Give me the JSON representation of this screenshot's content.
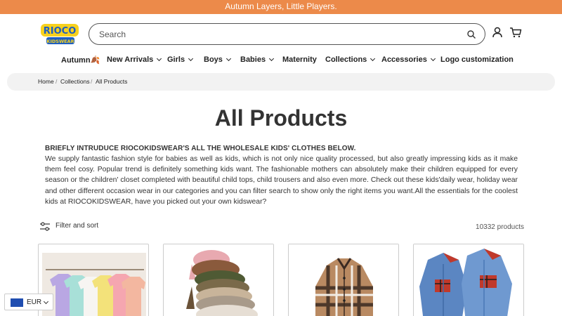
{
  "announcement": "Autumn Layers, Little Players.",
  "brand": {
    "logo_text_top": "RIOCO",
    "logo_text_bottom": "KIDSWEAR"
  },
  "search": {
    "placeholder": "Search"
  },
  "header_icons": [
    "account-icon",
    "cart-icon"
  ],
  "nav": {
    "items": [
      {
        "label": "Autumn🍂",
        "dropdown": false
      },
      {
        "label": "New Arrivals",
        "dropdown": true
      },
      {
        "label": "Girls",
        "dropdown": true
      },
      {
        "label": "Boys",
        "dropdown": true
      },
      {
        "label": "Babies",
        "dropdown": true
      },
      {
        "label": "Maternity",
        "dropdown": false
      },
      {
        "label": "Collections",
        "dropdown": true
      },
      {
        "label": "Accessories",
        "dropdown": true
      },
      {
        "label": "Logo customization",
        "dropdown": false
      }
    ]
  },
  "breadcrumb": {
    "home": "Home",
    "collections": "Collections",
    "current": "All Products",
    "separator": "/"
  },
  "page_title": "All Products",
  "intro": {
    "heading": "BRIEFLY INTRUDUCE RIOCOKIDSWEAR'S ALL THE WHOLESALE KIDS' CLOTHES BELOW.",
    "body": "We supply fantastic fashion style for babies as well as kids, which is not only nice quality processed, but also greatly impressing kids as it make them feel cosy. Popular trend is definitely something kids want. The fashionable mothers can absolutely make their children equipped for every season or the children' closet completed with beautiful child tops, child trousers and also even more. Check out these kids'daily wear, holiday wear and other different occasion wear in our categories and you can filter search to show only the right items you want.All the essentials for the coolest kids at RIOCOKIDSWEAR, have you picked out your own kidswear?"
  },
  "filter": {
    "label": "Filter and sort"
  },
  "product_count": "10332 products",
  "products": [
    {
      "image": "pastel-tshirts-on-hangers"
    },
    {
      "image": "stacked-knit-sweaters"
    },
    {
      "image": "plaid-shacket"
    },
    {
      "image": "denim-jackets-with-red-plaid"
    }
  ],
  "currency": {
    "code": "EUR"
  },
  "colors": {
    "announcement_bg": "#ec8a4a",
    "logo_yellow": "#f7d11e",
    "logo_blue": "#1f5fbf",
    "crumb_bg": "#f2f2f2"
  }
}
